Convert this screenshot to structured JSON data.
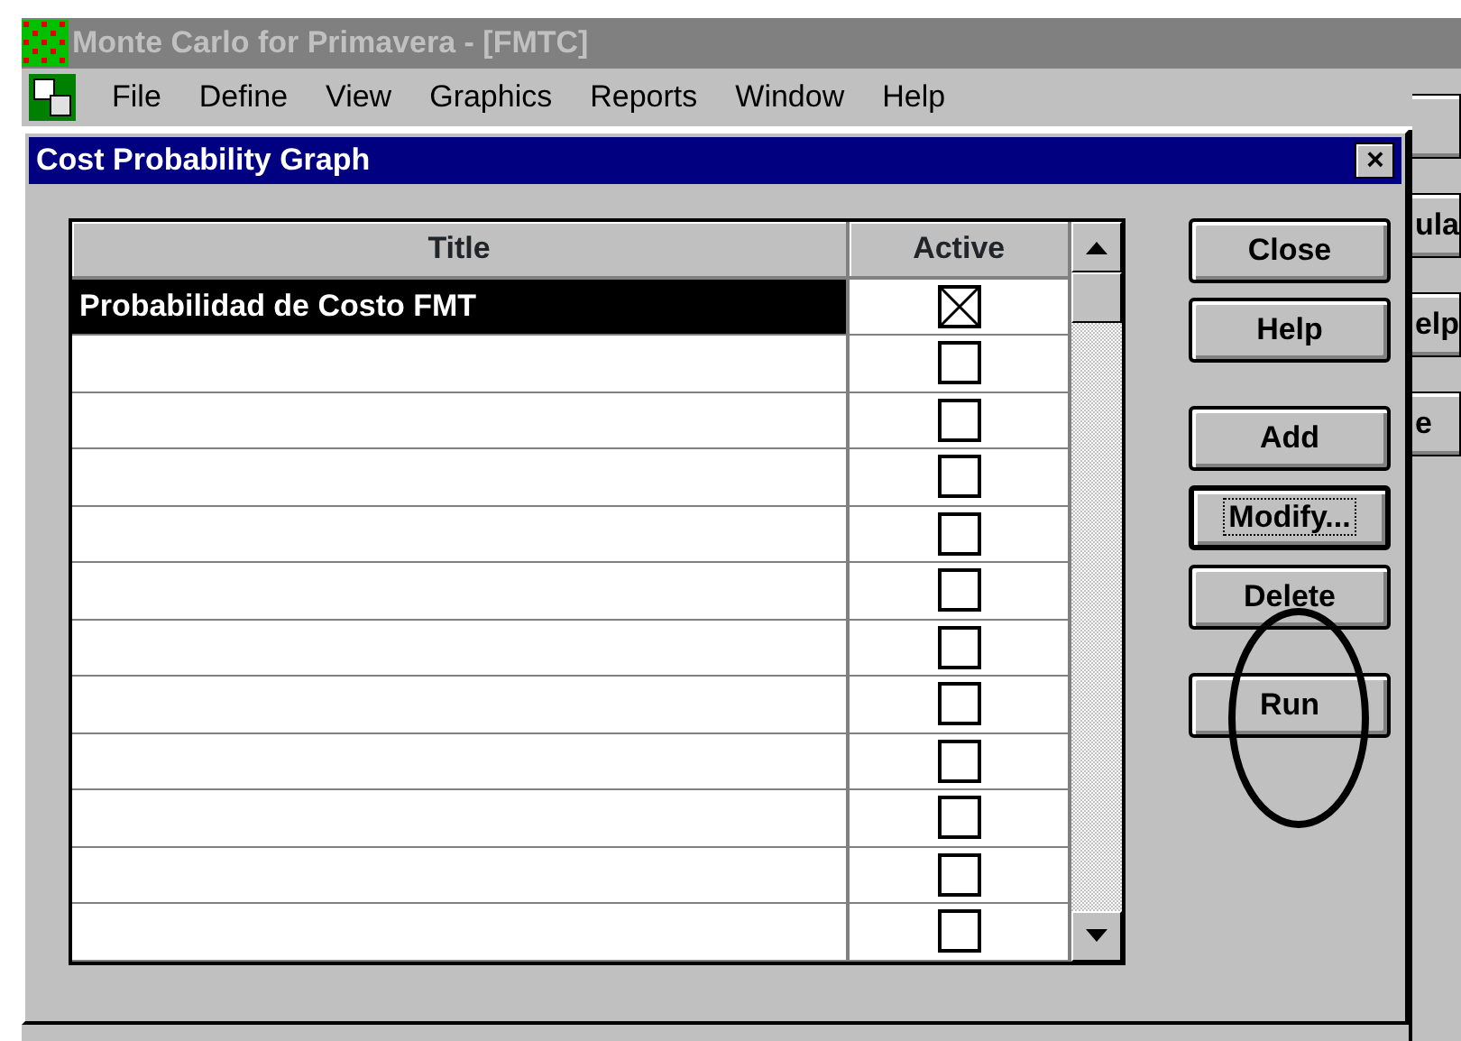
{
  "app": {
    "title": "Monte Carlo for Primavera - [FMTC]",
    "active": false
  },
  "menu": [
    "File",
    "Define",
    "View",
    "Graphics",
    "Reports",
    "Window",
    "Help"
  ],
  "dialog": {
    "title": "Cost Probability Graph",
    "close": "×",
    "table": {
      "columns": [
        "Title",
        "Active"
      ],
      "rows": [
        {
          "title": "Probabilidad de Costo FMT",
          "active": true,
          "selected": true
        },
        {
          "active": false,
          "selected": false
        },
        {
          "active": false,
          "selected": false
        },
        {
          "active": false,
          "selected": false
        },
        {
          "active": false,
          "selected": false
        },
        {
          "active": false,
          "selected": false
        },
        {
          "active": false,
          "selected": false
        },
        {
          "active": false,
          "selected": false
        },
        {
          "active": false,
          "selected": false
        },
        {
          "active": false,
          "selected": false
        },
        {
          "active": false,
          "selected": false
        },
        {
          "active": false,
          "selected": false
        }
      ]
    },
    "button_groups": [
      [
        {
          "label": "Close",
          "default": false
        },
        {
          "label": "Help",
          "default": false
        }
      ],
      [
        {
          "label": "Add",
          "default": false
        },
        {
          "label": "Modify...",
          "default": true
        },
        {
          "label": "Delete",
          "default": false
        }
      ],
      [
        {
          "label": "Run",
          "default": false
        }
      ]
    ]
  },
  "background_window": {
    "buttons": [
      "ula",
      "elp",
      "e"
    ]
  }
}
